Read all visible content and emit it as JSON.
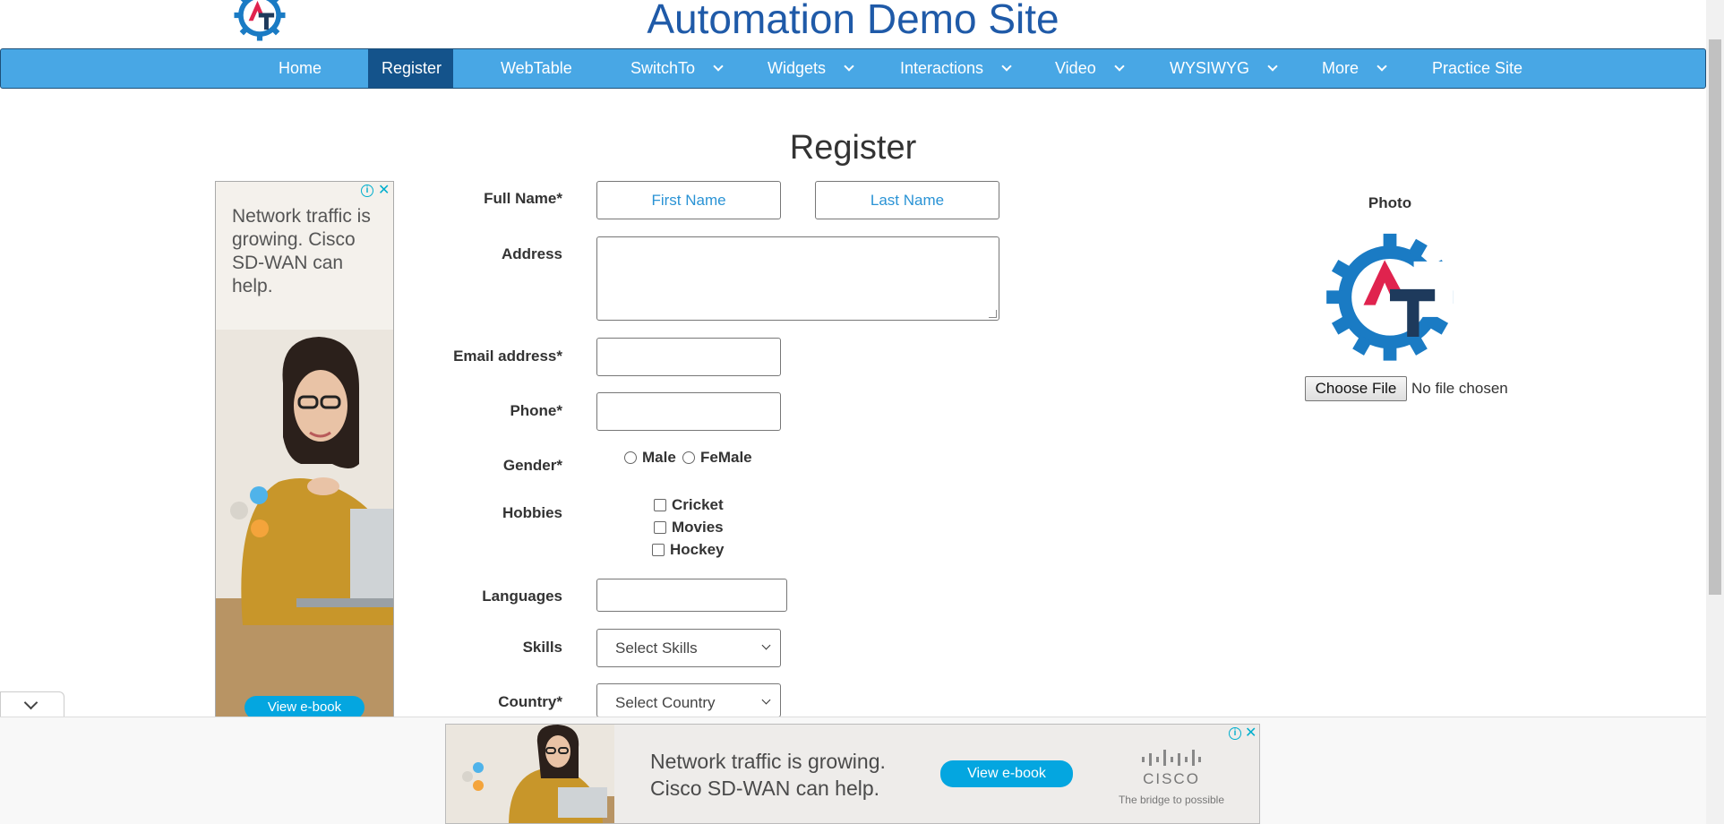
{
  "header": {
    "title": "Automation Demo Site"
  },
  "nav": {
    "items": [
      {
        "label": "Home"
      },
      {
        "label": "Register"
      },
      {
        "label": "WebTable"
      },
      {
        "label": "SwitchTo"
      },
      {
        "label": "Widgets"
      },
      {
        "label": "Interactions"
      },
      {
        "label": "Video"
      },
      {
        "label": "WYSIWYG"
      },
      {
        "label": "More"
      },
      {
        "label": "Practice Site"
      }
    ],
    "active": "Register"
  },
  "main": {
    "heading": "Register"
  },
  "form": {
    "full_name_label": "Full Name*",
    "first_name_placeholder": "First Name",
    "last_name_placeholder": "Last Name",
    "address_label": "Address",
    "email_label": "Email address*",
    "phone_label": "Phone*",
    "gender_label": "Gender*",
    "gender_options": [
      "Male",
      "FeMale"
    ],
    "hobbies_label": "Hobbies",
    "hobbies_options": [
      "Cricket",
      "Movies",
      "Hockey"
    ],
    "languages_label": "Languages",
    "skills_label": "Skills",
    "skills_selected": "Select Skills",
    "country_label": "Country*",
    "country_selected": "Select Country"
  },
  "photo": {
    "label": "Photo",
    "choose_file_label": "Choose File",
    "status": "No file chosen"
  },
  "left_ad": {
    "text": "Network traffic is growing. Cisco SD-WAN can help.",
    "button": "View e-book",
    "info_icon": "i",
    "close_icon": "✕"
  },
  "bottom_ad": {
    "line1": "Network traffic is growing.",
    "line2": "Cisco SD-WAN can help.",
    "button": "View e-book",
    "brand": "CISCO",
    "tagline": "The bridge to possible",
    "info_icon": "i",
    "close_icon": "✕"
  },
  "colors": {
    "nav_bg": "#48a7e5",
    "nav_active": "#14538b",
    "title": "#1f5aa8",
    "placeholder": "#2a93d5",
    "ad_button": "#04a6e0"
  }
}
